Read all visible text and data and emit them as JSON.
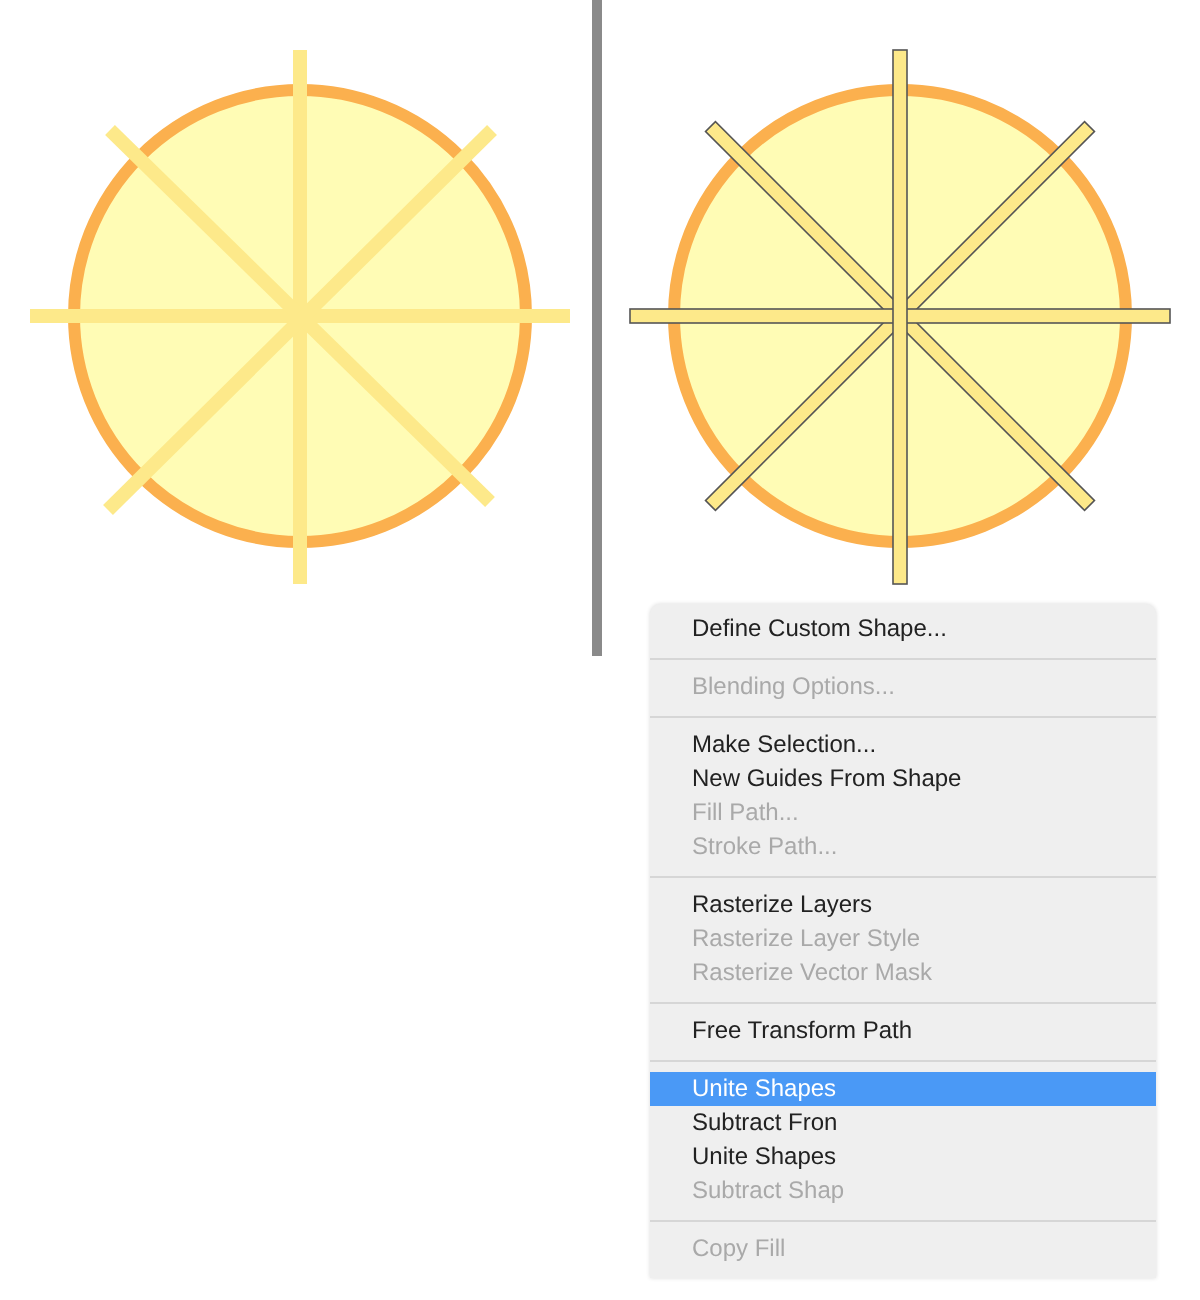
{
  "canvases": [
    {
      "kind": "merged"
    },
    {
      "kind": "separate"
    }
  ],
  "context_menu": {
    "groups": [
      [
        {
          "label": "Define Custom Shape...",
          "disabled": false,
          "selected": false
        }
      ],
      [
        {
          "label": "Blending Options...",
          "disabled": true,
          "selected": false
        }
      ],
      [
        {
          "label": "Make Selection...",
          "disabled": false,
          "selected": false
        },
        {
          "label": "New Guides From Shape",
          "disabled": false,
          "selected": false
        },
        {
          "label": "Fill Path...",
          "disabled": true,
          "selected": false
        },
        {
          "label": "Stroke Path...",
          "disabled": true,
          "selected": false
        }
      ],
      [
        {
          "label": "Rasterize Layers",
          "disabled": false,
          "selected": false
        },
        {
          "label": "Rasterize Layer Style",
          "disabled": true,
          "selected": false
        },
        {
          "label": "Rasterize Vector Mask",
          "disabled": true,
          "selected": false
        }
      ],
      [
        {
          "label": "Free Transform Path",
          "disabled": false,
          "selected": false
        }
      ],
      [
        {
          "label": "Unite Shapes",
          "disabled": false,
          "selected": true
        },
        {
          "label": "Subtract Fron",
          "disabled": false,
          "selected": false
        },
        {
          "label": "Unite Shapes",
          "disabled": false,
          "selected": false
        },
        {
          "label": "Subtract Shap",
          "disabled": true,
          "selected": false
        }
      ],
      [
        {
          "label": "Copy Fill",
          "disabled": true,
          "selected": false
        }
      ]
    ]
  }
}
